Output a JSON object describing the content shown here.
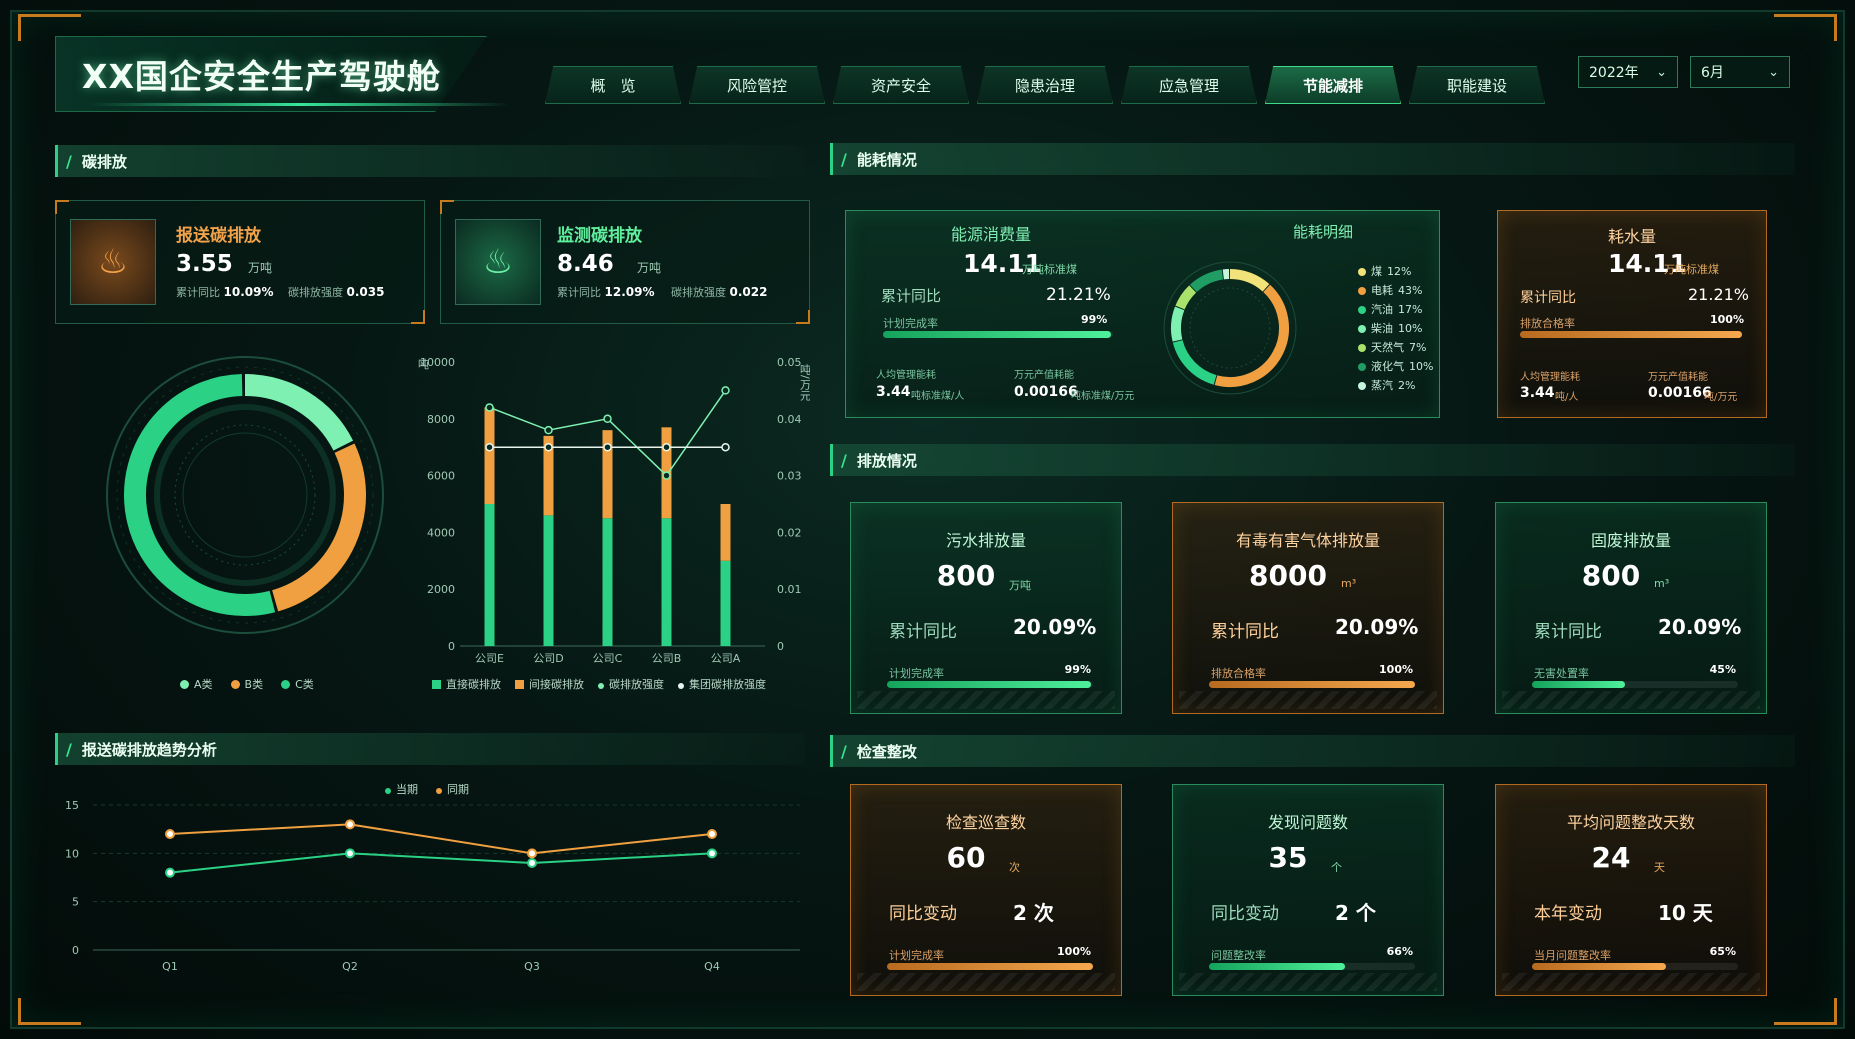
{
  "app_title": "XX国企安全生产驾驶舱",
  "tabs": [
    {
      "label": "概　览",
      "active": false
    },
    {
      "label": "风险管控",
      "active": false
    },
    {
      "label": "资产安全",
      "active": false
    },
    {
      "label": "隐患治理",
      "active": false
    },
    {
      "label": "应急管理",
      "active": false
    },
    {
      "label": "节能减排",
      "active": true
    },
    {
      "label": "职能建设",
      "active": false
    }
  ],
  "filters": {
    "year": "2022年",
    "month": "6月"
  },
  "colors": {
    "green": "#2bd184",
    "orange": "#f0a040",
    "light_green": "#7ef0b2",
    "accent": "#c77a1e"
  },
  "carbon": {
    "title": "碳排放",
    "reported": {
      "title": "报送碳排放",
      "value": "3.55",
      "unit": "万吨",
      "yoy_label": "累计同比",
      "yoy": "10.09%",
      "intensity_label": "碳排放强度",
      "intensity": "0.035",
      "icon": "co2-orange-icon"
    },
    "monitored": {
      "title": "监测碳排放",
      "value": "8.46",
      "unit": "万吨",
      "yoy_label": "累计同比",
      "yoy": "12.09%",
      "intensity_label": "碳排放强度",
      "intensity": "0.022",
      "icon": "co2-green-icon"
    },
    "donut_legend": [
      "A类",
      "B类",
      "C类"
    ],
    "bar_legend": [
      "直接碳排放",
      "间接碳排放",
      "碳排放强度",
      "集团碳排放强度"
    ],
    "y_left_unit": "吨",
    "y_right_unit": "吨/万元"
  },
  "trend": {
    "title": "报送碳排放趋势分析",
    "legend": [
      "当期",
      "同期"
    ]
  },
  "energy": {
    "title": "能耗情况",
    "consumption": {
      "title": "能源消费量",
      "value": "14.11",
      "unit": "万吨标准煤",
      "yoy_label": "累计同比",
      "yoy": "21.21%",
      "plan_label": "计划完成率",
      "plan": "99%",
      "per_capita_label": "人均管理能耗",
      "per_capita": "3.44",
      "per_capita_unit": "吨标准煤/人",
      "per_output_label": "万元产值耗能",
      "per_output": "0.00166",
      "per_output_unit": "吨标准煤/万元"
    },
    "detail_title": "能耗明细",
    "detail": [
      {
        "name": "煤",
        "pct": "12%",
        "color": "#f2e27a"
      },
      {
        "name": "电耗",
        "pct": "43%",
        "color": "#f0a040"
      },
      {
        "name": "汽油",
        "pct": "17%",
        "color": "#2bd184"
      },
      {
        "name": "柴油",
        "pct": "10%",
        "color": "#7ef0b2"
      },
      {
        "name": "天然气",
        "pct": "7%",
        "color": "#a9e36b"
      },
      {
        "name": "液化气",
        "pct": "10%",
        "color": "#1f9d62"
      },
      {
        "name": "蒸汽",
        "pct": "2%",
        "color": "#c6f5de"
      }
    ],
    "water": {
      "title": "耗水量",
      "value": "14.11",
      "unit": "万吨标准煤",
      "yoy_label": "累计同比",
      "yoy": "21.21%",
      "plan_label": "排放合格率",
      "plan": "100%",
      "per_capita_label": "人均管理能耗",
      "per_capita": "3.44",
      "per_capita_unit": "吨/人",
      "per_output_label": "万元产值耗能",
      "per_output": "0.00166",
      "per_output_unit": "吨/万元"
    }
  },
  "emission": {
    "title": "排放情况",
    "cards": [
      {
        "title": "污水排放量",
        "value": "800",
        "unit": "万吨",
        "row_label": "累计同比",
        "row_value": "20.09%",
        "bar_label": "计划完成率",
        "bar_value": "99%",
        "bar_pct": 0.99,
        "theme": "g"
      },
      {
        "title": "有毒有害气体排放量",
        "value": "8000",
        "unit": "m³",
        "row_label": "累计同比",
        "row_value": "20.09%",
        "bar_label": "排放合格率",
        "bar_value": "100%",
        "bar_pct": 1.0,
        "theme": "o"
      },
      {
        "title": "固废排放量",
        "value": "800",
        "unit": "m³",
        "row_label": "累计同比",
        "row_value": "20.09%",
        "bar_label": "无害处置率",
        "bar_value": "45%",
        "bar_pct": 0.45,
        "theme": "g"
      }
    ]
  },
  "inspection": {
    "title": "检查整改",
    "cards": [
      {
        "title": "检查巡查数",
        "value": "60",
        "unit": "次",
        "row_label": "同比变动",
        "row_value": "2 次",
        "bar_label": "计划完成率",
        "bar_value": "100%",
        "bar_pct": 1.0,
        "theme": "o"
      },
      {
        "title": "发现问题数",
        "value": "35",
        "unit": "个",
        "row_label": "同比变动",
        "row_value": "2 个",
        "bar_label": "问题整改率",
        "bar_value": "66%",
        "bar_pct": 0.66,
        "theme": "g"
      },
      {
        "title": "平均问题整改天数",
        "value": "24",
        "unit": "天",
        "row_label": "本年变动",
        "row_value": "10 天",
        "bar_label": "当月问题整改率",
        "bar_value": "65%",
        "bar_pct": 0.65,
        "theme": "o"
      }
    ]
  },
  "chart_data": [
    {
      "type": "pie",
      "title": "",
      "labels": [
        "A类",
        "B类",
        "C类"
      ],
      "values": [
        18,
        28,
        54
      ],
      "colors": [
        "#7ef0b2",
        "#f0a040",
        "#2bd184"
      ]
    },
    {
      "type": "bar",
      "title": "",
      "categories": [
        "公司E",
        "公司D",
        "公司C",
        "公司B",
        "公司A"
      ],
      "ylabel": "吨",
      "y2label": "吨/万元",
      "ylim": [
        0,
        10000
      ],
      "y2lim": [
        0,
        0.05
      ],
      "yticks": [
        0,
        2000,
        4000,
        6000,
        8000,
        10000
      ],
      "y2ticks": [
        0,
        0.01,
        0.02,
        0.03,
        0.04,
        0.05
      ],
      "series": [
        {
          "name": "直接碳排放",
          "kind": "bar",
          "values": [
            5000,
            4600,
            4500,
            4500,
            3000
          ],
          "color": "#2bd184"
        },
        {
          "name": "间接碳排放",
          "kind": "bar",
          "values": [
            3400,
            2800,
            3100,
            3200,
            2000
          ],
          "color": "#f0a040"
        },
        {
          "name": "碳排放强度",
          "kind": "line",
          "axis": "right",
          "values": [
            0.042,
            0.038,
            0.04,
            0.03,
            0.045
          ],
          "color": "#7ef0b2"
        },
        {
          "name": "集团碳排放强度",
          "kind": "line",
          "axis": "right",
          "values": [
            0.035,
            0.035,
            0.035,
            0.035,
            0.035
          ],
          "color": "#e8f5ee"
        }
      ]
    },
    {
      "type": "line",
      "title": "",
      "categories": [
        "Q1",
        "Q2",
        "Q3",
        "Q4"
      ],
      "ylim": [
        0,
        15
      ],
      "yticks": [
        0,
        5,
        10,
        15
      ],
      "series": [
        {
          "name": "当期",
          "values": [
            8,
            10,
            9,
            10
          ],
          "color": "#2bd184"
        },
        {
          "name": "同期",
          "values": [
            12,
            13,
            10,
            12
          ],
          "color": "#f0a040"
        }
      ]
    },
    {
      "type": "pie",
      "title": "",
      "labels": [
        "煤",
        "电耗",
        "汽油",
        "柴油",
        "天然气",
        "液化气",
        "蒸汽"
      ],
      "values": [
        12,
        43,
        17,
        10,
        7,
        10,
        2
      ],
      "colors": [
        "#f2e27a",
        "#f0a040",
        "#2bd184",
        "#7ef0b2",
        "#a9e36b",
        "#1f9d62",
        "#c6f5de"
      ]
    }
  ]
}
